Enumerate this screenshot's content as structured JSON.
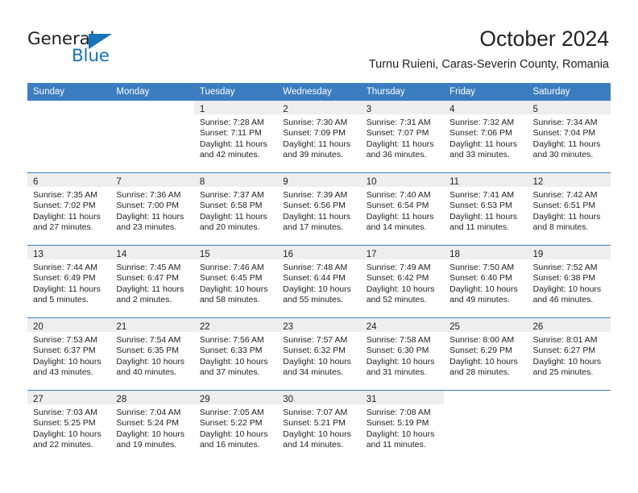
{
  "logo": {
    "word_top": "General",
    "word_bottom": "Blue",
    "triangle_color": "#1574bb",
    "text_color": "#231f20"
  },
  "header": {
    "month_title": "October 2024",
    "location": "Turnu Ruieni, Caras-Severin County, Romania"
  },
  "theme": {
    "header_bar_color": "#3b7dc0",
    "daynum_band_color": "#eeeeee",
    "text_color": "#222222"
  },
  "weekday_headers": [
    "Sunday",
    "Monday",
    "Tuesday",
    "Wednesday",
    "Thursday",
    "Friday",
    "Saturday"
  ],
  "weeks": [
    [
      {
        "empty": true
      },
      {
        "empty": true
      },
      {
        "day": "1",
        "sunrise": "Sunrise: 7:28 AM",
        "sunset": "Sunset: 7:11 PM",
        "daylight_line1": "Daylight: 11 hours",
        "daylight_line2": "and 42 minutes."
      },
      {
        "day": "2",
        "sunrise": "Sunrise: 7:30 AM",
        "sunset": "Sunset: 7:09 PM",
        "daylight_line1": "Daylight: 11 hours",
        "daylight_line2": "and 39 minutes."
      },
      {
        "day": "3",
        "sunrise": "Sunrise: 7:31 AM",
        "sunset": "Sunset: 7:07 PM",
        "daylight_line1": "Daylight: 11 hours",
        "daylight_line2": "and 36 minutes."
      },
      {
        "day": "4",
        "sunrise": "Sunrise: 7:32 AM",
        "sunset": "Sunset: 7:06 PM",
        "daylight_line1": "Daylight: 11 hours",
        "daylight_line2": "and 33 minutes."
      },
      {
        "day": "5",
        "sunrise": "Sunrise: 7:34 AM",
        "sunset": "Sunset: 7:04 PM",
        "daylight_line1": "Daylight: 11 hours",
        "daylight_line2": "and 30 minutes."
      }
    ],
    [
      {
        "day": "6",
        "sunrise": "Sunrise: 7:35 AM",
        "sunset": "Sunset: 7:02 PM",
        "daylight_line1": "Daylight: 11 hours",
        "daylight_line2": "and 27 minutes."
      },
      {
        "day": "7",
        "sunrise": "Sunrise: 7:36 AM",
        "sunset": "Sunset: 7:00 PM",
        "daylight_line1": "Daylight: 11 hours",
        "daylight_line2": "and 23 minutes."
      },
      {
        "day": "8",
        "sunrise": "Sunrise: 7:37 AM",
        "sunset": "Sunset: 6:58 PM",
        "daylight_line1": "Daylight: 11 hours",
        "daylight_line2": "and 20 minutes."
      },
      {
        "day": "9",
        "sunrise": "Sunrise: 7:39 AM",
        "sunset": "Sunset: 6:56 PM",
        "daylight_line1": "Daylight: 11 hours",
        "daylight_line2": "and 17 minutes."
      },
      {
        "day": "10",
        "sunrise": "Sunrise: 7:40 AM",
        "sunset": "Sunset: 6:54 PM",
        "daylight_line1": "Daylight: 11 hours",
        "daylight_line2": "and 14 minutes."
      },
      {
        "day": "11",
        "sunrise": "Sunrise: 7:41 AM",
        "sunset": "Sunset: 6:53 PM",
        "daylight_line1": "Daylight: 11 hours",
        "daylight_line2": "and 11 minutes."
      },
      {
        "day": "12",
        "sunrise": "Sunrise: 7:42 AM",
        "sunset": "Sunset: 6:51 PM",
        "daylight_line1": "Daylight: 11 hours",
        "daylight_line2": "and 8 minutes."
      }
    ],
    [
      {
        "day": "13",
        "sunrise": "Sunrise: 7:44 AM",
        "sunset": "Sunset: 6:49 PM",
        "daylight_line1": "Daylight: 11 hours",
        "daylight_line2": "and 5 minutes."
      },
      {
        "day": "14",
        "sunrise": "Sunrise: 7:45 AM",
        "sunset": "Sunset: 6:47 PM",
        "daylight_line1": "Daylight: 11 hours",
        "daylight_line2": "and 2 minutes."
      },
      {
        "day": "15",
        "sunrise": "Sunrise: 7:46 AM",
        "sunset": "Sunset: 6:45 PM",
        "daylight_line1": "Daylight: 10 hours",
        "daylight_line2": "and 58 minutes."
      },
      {
        "day": "16",
        "sunrise": "Sunrise: 7:48 AM",
        "sunset": "Sunset: 6:44 PM",
        "daylight_line1": "Daylight: 10 hours",
        "daylight_line2": "and 55 minutes."
      },
      {
        "day": "17",
        "sunrise": "Sunrise: 7:49 AM",
        "sunset": "Sunset: 6:42 PM",
        "daylight_line1": "Daylight: 10 hours",
        "daylight_line2": "and 52 minutes."
      },
      {
        "day": "18",
        "sunrise": "Sunrise: 7:50 AM",
        "sunset": "Sunset: 6:40 PM",
        "daylight_line1": "Daylight: 10 hours",
        "daylight_line2": "and 49 minutes."
      },
      {
        "day": "19",
        "sunrise": "Sunrise: 7:52 AM",
        "sunset": "Sunset: 6:38 PM",
        "daylight_line1": "Daylight: 10 hours",
        "daylight_line2": "and 46 minutes."
      }
    ],
    [
      {
        "day": "20",
        "sunrise": "Sunrise: 7:53 AM",
        "sunset": "Sunset: 6:37 PM",
        "daylight_line1": "Daylight: 10 hours",
        "daylight_line2": "and 43 minutes."
      },
      {
        "day": "21",
        "sunrise": "Sunrise: 7:54 AM",
        "sunset": "Sunset: 6:35 PM",
        "daylight_line1": "Daylight: 10 hours",
        "daylight_line2": "and 40 minutes."
      },
      {
        "day": "22",
        "sunrise": "Sunrise: 7:56 AM",
        "sunset": "Sunset: 6:33 PM",
        "daylight_line1": "Daylight: 10 hours",
        "daylight_line2": "and 37 minutes."
      },
      {
        "day": "23",
        "sunrise": "Sunrise: 7:57 AM",
        "sunset": "Sunset: 6:32 PM",
        "daylight_line1": "Daylight: 10 hours",
        "daylight_line2": "and 34 minutes."
      },
      {
        "day": "24",
        "sunrise": "Sunrise: 7:58 AM",
        "sunset": "Sunset: 6:30 PM",
        "daylight_line1": "Daylight: 10 hours",
        "daylight_line2": "and 31 minutes."
      },
      {
        "day": "25",
        "sunrise": "Sunrise: 8:00 AM",
        "sunset": "Sunset: 6:29 PM",
        "daylight_line1": "Daylight: 10 hours",
        "daylight_line2": "and 28 minutes."
      },
      {
        "day": "26",
        "sunrise": "Sunrise: 8:01 AM",
        "sunset": "Sunset: 6:27 PM",
        "daylight_line1": "Daylight: 10 hours",
        "daylight_line2": "and 25 minutes."
      }
    ],
    [
      {
        "day": "27",
        "sunrise": "Sunrise: 7:03 AM",
        "sunset": "Sunset: 5:25 PM",
        "daylight_line1": "Daylight: 10 hours",
        "daylight_line2": "and 22 minutes."
      },
      {
        "day": "28",
        "sunrise": "Sunrise: 7:04 AM",
        "sunset": "Sunset: 5:24 PM",
        "daylight_line1": "Daylight: 10 hours",
        "daylight_line2": "and 19 minutes."
      },
      {
        "day": "29",
        "sunrise": "Sunrise: 7:05 AM",
        "sunset": "Sunset: 5:22 PM",
        "daylight_line1": "Daylight: 10 hours",
        "daylight_line2": "and 16 minutes."
      },
      {
        "day": "30",
        "sunrise": "Sunrise: 7:07 AM",
        "sunset": "Sunset: 5:21 PM",
        "daylight_line1": "Daylight: 10 hours",
        "daylight_line2": "and 14 minutes."
      },
      {
        "day": "31",
        "sunrise": "Sunrise: 7:08 AM",
        "sunset": "Sunset: 5:19 PM",
        "daylight_line1": "Daylight: 10 hours",
        "daylight_line2": "and 11 minutes."
      },
      {
        "empty": true
      },
      {
        "empty": true
      }
    ]
  ]
}
